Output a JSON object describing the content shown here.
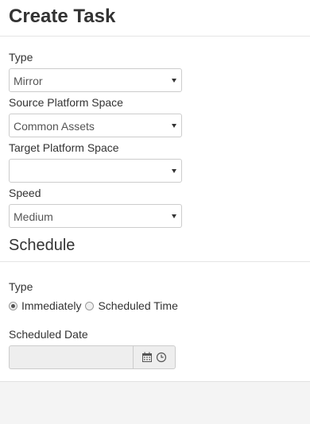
{
  "header": {
    "title": "Create Task"
  },
  "form": {
    "type": {
      "label": "Type",
      "value": "Mirror"
    },
    "source_space": {
      "label": "Source Platform Space",
      "value": "Common Assets"
    },
    "target_space": {
      "label": "Target Platform Space",
      "value": ""
    },
    "speed": {
      "label": "Speed",
      "value": "Medium"
    }
  },
  "schedule": {
    "title": "Schedule",
    "type_label": "Type",
    "options": [
      {
        "label": "Immediately",
        "checked": true
      },
      {
        "label": "Scheduled Time",
        "checked": false
      }
    ],
    "date_label": "Scheduled Date",
    "date_value": "",
    "icons": [
      "calendar-icon",
      "clock-icon"
    ]
  },
  "colors": {
    "text": "#333333",
    "border": "#cccccc",
    "disabled_bg": "#eeeeee",
    "footer_bg": "#f4f4f4"
  }
}
